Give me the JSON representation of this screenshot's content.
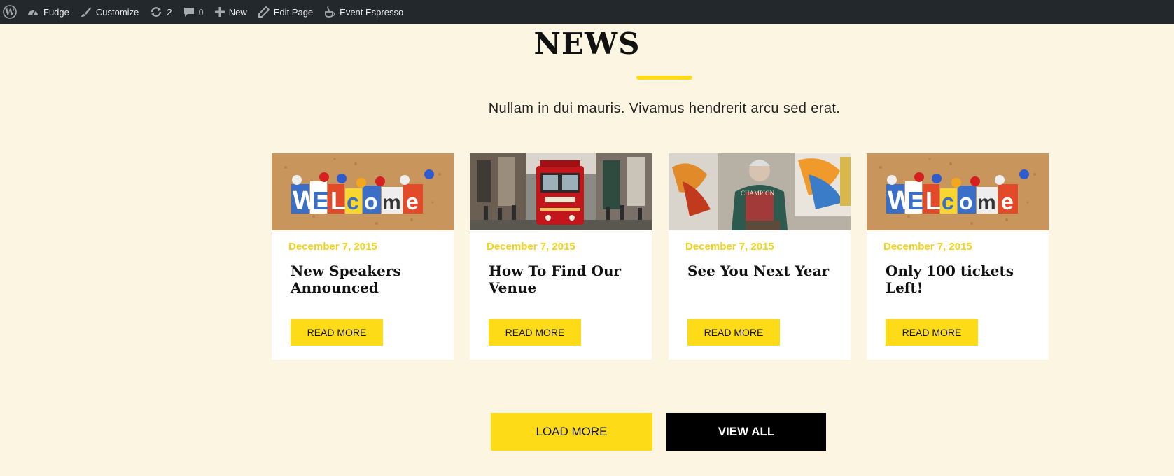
{
  "adminbar": {
    "site_name": "Fudge",
    "customize": "Customize",
    "updates_count": "2",
    "comments_count": "0",
    "new_label": "New",
    "edit_page": "Edit Page",
    "event_espresso": "Event Espresso"
  },
  "section": {
    "title": "NEWS",
    "subtitle": "Nullam in dui mauris. Vivamus hendrerit arcu sed erat."
  },
  "cards": [
    {
      "date": "December 7, 2015",
      "title": "New Speakers Announced",
      "button": "READ MORE",
      "image": "welcome-corkboard"
    },
    {
      "date": "December 7, 2015",
      "title": "How To Find Our Venue",
      "button": "READ MORE",
      "image": "red-tram-street"
    },
    {
      "date": "December 7, 2015",
      "title": "See You Next Year",
      "button": "READ MORE",
      "image": "painter-artist"
    },
    {
      "date": "December 7, 2015",
      "title": "Only 100 tickets Left!",
      "button": "READ MORE",
      "image": "welcome-corkboard"
    }
  ],
  "buttons": {
    "load_more": "LOAD MORE",
    "view_all": "VIEW ALL"
  },
  "colors": {
    "accent": "#fddb17",
    "date": "#f3d318",
    "background": "#fbf5e1",
    "adminbar": "#23282d"
  }
}
